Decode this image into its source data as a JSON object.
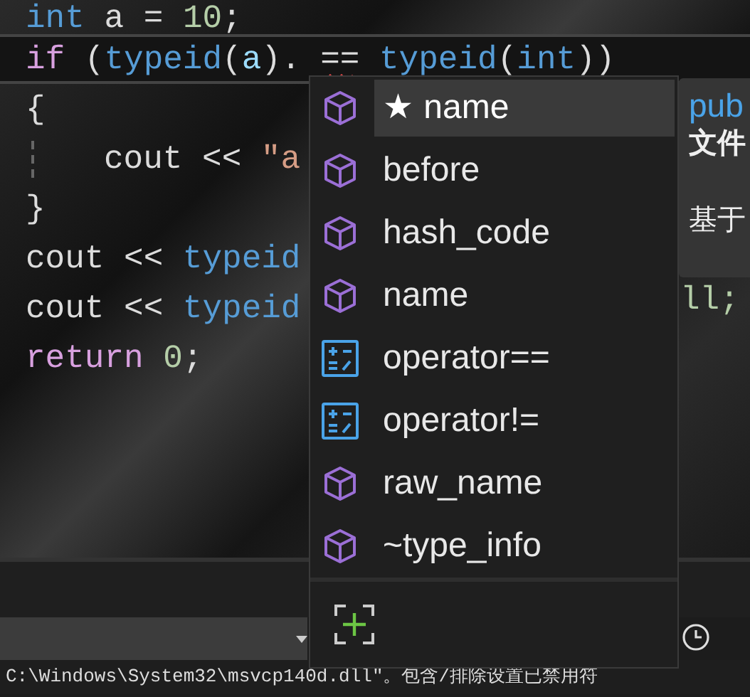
{
  "code_lines": [
    {
      "tokens": [
        {
          "text": "int",
          "kind": "type"
        },
        {
          "text": " a = ",
          "kind": "plain"
        },
        {
          "text": "10",
          "kind": "number"
        },
        {
          "text": ";",
          "kind": "plain"
        }
      ],
      "current": false,
      "indent": false
    },
    {
      "tokens": [
        {
          "text": "if",
          "kind": "keyword"
        },
        {
          "text": " (",
          "kind": "plain"
        },
        {
          "text": "typeid",
          "kind": "type"
        },
        {
          "text": "(",
          "kind": "plain"
        },
        {
          "text": "a",
          "kind": "var"
        },
        {
          "text": "). == ",
          "kind": "plain"
        },
        {
          "text": "typeid",
          "kind": "type"
        },
        {
          "text": "(",
          "kind": "plain"
        },
        {
          "text": "int",
          "kind": "type"
        },
        {
          "text": "))",
          "kind": "plain"
        }
      ],
      "current": true,
      "indent": false
    },
    {
      "tokens": [
        {
          "text": "{",
          "kind": "plain"
        }
      ],
      "current": false,
      "indent": false
    },
    {
      "tokens": [
        {
          "text": "cout << ",
          "kind": "plain"
        },
        {
          "text": "\"a",
          "kind": "string"
        }
      ],
      "current": false,
      "indent": true
    },
    {
      "tokens": [
        {
          "text": "}",
          "kind": "plain"
        }
      ],
      "current": false,
      "indent": false
    },
    {
      "tokens": [
        {
          "text": "cout << ",
          "kind": "plain"
        },
        {
          "text": "typeid",
          "kind": "type"
        }
      ],
      "current": false,
      "indent": false
    },
    {
      "tokens": [
        {
          "text": "cout << ",
          "kind": "plain"
        },
        {
          "text": "typeid",
          "kind": "type"
        }
      ],
      "current": false,
      "indent": false
    },
    {
      "tokens": [
        {
          "text": "return",
          "kind": "keyword"
        },
        {
          "text": " 0",
          "kind": "number"
        },
        {
          "text": ";",
          "kind": "plain"
        }
      ],
      "current": false,
      "indent": false
    }
  ],
  "code_fragment": "ll;",
  "completion": {
    "items": [
      {
        "label": "★ name",
        "kind": "member",
        "selected": true
      },
      {
        "label": "before",
        "kind": "member",
        "selected": false
      },
      {
        "label": "hash_code",
        "kind": "member",
        "selected": false
      },
      {
        "label": "name",
        "kind": "member",
        "selected": false
      },
      {
        "label": "operator==",
        "kind": "operator",
        "selected": false
      },
      {
        "label": "operator!=",
        "kind": "operator",
        "selected": false
      },
      {
        "label": "raw_name",
        "kind": "member",
        "selected": false
      },
      {
        "label": "~type_info",
        "kind": "member",
        "selected": false
      }
    ]
  },
  "tooltip": {
    "signature": "pub",
    "file": "文件",
    "description": "基于"
  },
  "output_line": "C:\\Windows\\System32\\msvcp140d.dll\"。包含/排除设置已禁用符"
}
